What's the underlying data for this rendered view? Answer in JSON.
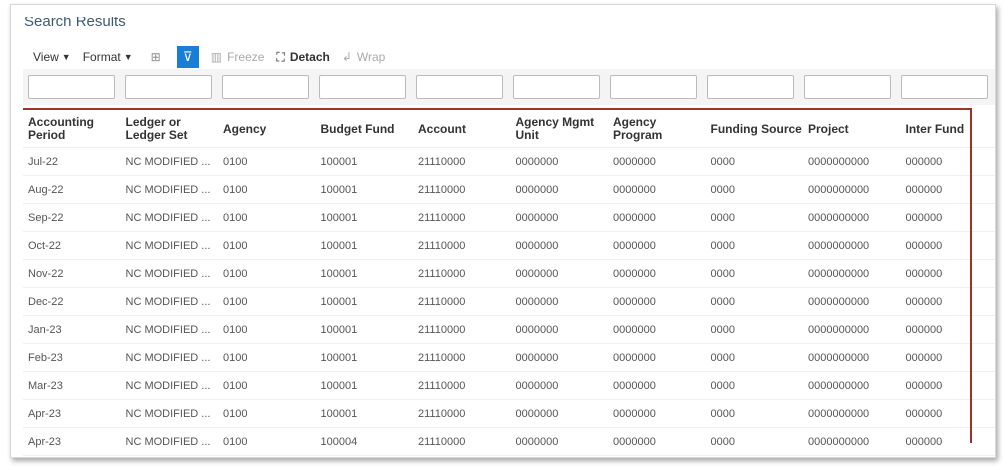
{
  "title": "Search Results",
  "toolbar": {
    "view": "View",
    "format": "Format",
    "freeze": "Freeze",
    "detach": "Detach",
    "wrap": "Wrap"
  },
  "columns": [
    "Accounting Period",
    "Ledger or Ledger Set",
    "Agency",
    "Budget Fund",
    "Account",
    "Agency Mgmt Unit",
    "Agency Program",
    "Funding Source",
    "Project",
    "Inter Fund"
  ],
  "rows": [
    [
      "Jul-22",
      "NC MODIFIED ...",
      "0100",
      "100001",
      "21110000",
      "0000000",
      "0000000",
      "0000",
      "0000000000",
      "000000"
    ],
    [
      "Aug-22",
      "NC MODIFIED ...",
      "0100",
      "100001",
      "21110000",
      "0000000",
      "0000000",
      "0000",
      "0000000000",
      "000000"
    ],
    [
      "Sep-22",
      "NC MODIFIED ...",
      "0100",
      "100001",
      "21110000",
      "0000000",
      "0000000",
      "0000",
      "0000000000",
      "000000"
    ],
    [
      "Oct-22",
      "NC MODIFIED ...",
      "0100",
      "100001",
      "21110000",
      "0000000",
      "0000000",
      "0000",
      "0000000000",
      "000000"
    ],
    [
      "Nov-22",
      "NC MODIFIED ...",
      "0100",
      "100001",
      "21110000",
      "0000000",
      "0000000",
      "0000",
      "0000000000",
      "000000"
    ],
    [
      "Dec-22",
      "NC MODIFIED ...",
      "0100",
      "100001",
      "21110000",
      "0000000",
      "0000000",
      "0000",
      "0000000000",
      "000000"
    ],
    [
      "Jan-23",
      "NC MODIFIED ...",
      "0100",
      "100001",
      "21110000",
      "0000000",
      "0000000",
      "0000",
      "0000000000",
      "000000"
    ],
    [
      "Feb-23",
      "NC MODIFIED ...",
      "0100",
      "100001",
      "21110000",
      "0000000",
      "0000000",
      "0000",
      "0000000000",
      "000000"
    ],
    [
      "Mar-23",
      "NC MODIFIED ...",
      "0100",
      "100001",
      "21110000",
      "0000000",
      "0000000",
      "0000",
      "0000000000",
      "000000"
    ],
    [
      "Apr-23",
      "NC MODIFIED ...",
      "0100",
      "100001",
      "21110000",
      "0000000",
      "0000000",
      "0000",
      "0000000000",
      "000000"
    ],
    [
      "Apr-23",
      "NC MODIFIED ...",
      "0100",
      "100004",
      "21110000",
      "0000000",
      "0000000",
      "0000",
      "0000000000",
      "000000"
    ]
  ]
}
